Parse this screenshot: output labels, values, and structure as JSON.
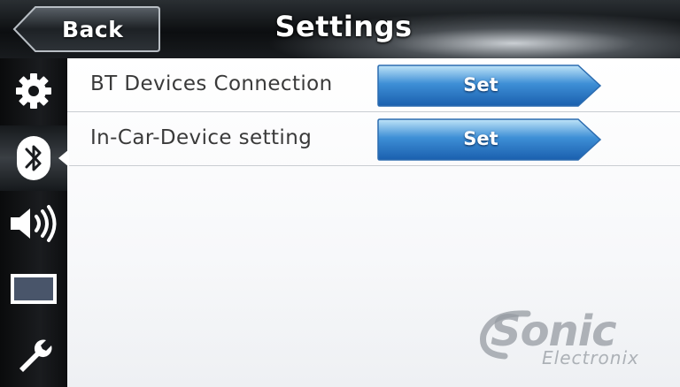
{
  "header": {
    "back_label": "Back",
    "title": "Settings"
  },
  "sidebar": {
    "items": [
      {
        "icon": "gear-icon",
        "active": false
      },
      {
        "icon": "bluetooth-icon",
        "active": true
      },
      {
        "icon": "speaker-icon",
        "active": false
      },
      {
        "icon": "display-icon",
        "active": false
      },
      {
        "icon": "wrench-icon",
        "active": false
      }
    ]
  },
  "rows": [
    {
      "label": "BT Devices Connection",
      "button": "Set"
    },
    {
      "label": "In-Car-Device setting",
      "button": "Set"
    }
  ],
  "watermark": {
    "brand": "Sonic",
    "sub": "Electronix"
  },
  "colors": {
    "button_blue": "#1f6fc0",
    "button_light": "#7ec4f0",
    "sidebar": "#141618",
    "content_bg": "#ffffff"
  }
}
